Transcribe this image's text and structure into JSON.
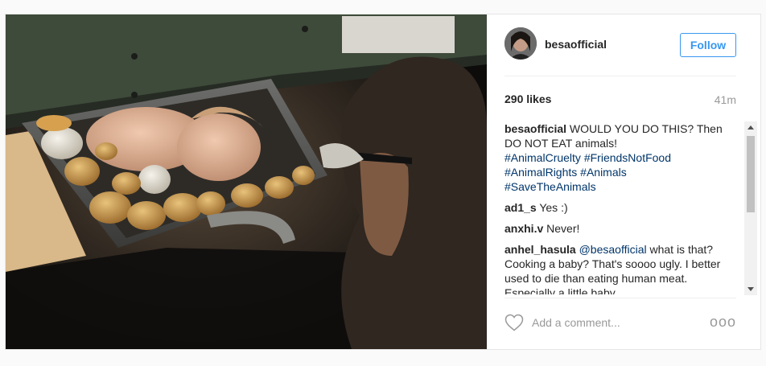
{
  "post": {
    "username": "besaofficial",
    "follow_label": "Follow",
    "likes": "290 likes",
    "time_ago": "41m",
    "caption": {
      "user": "besaofficial",
      "text": "WOULD YOU DO THIS? Then DO NOT EAT animals!",
      "hashtags": [
        "#AnimalCruelty",
        "#FriendsNotFood",
        "#AnimalRights",
        "#Animals",
        "#SaveTheAnimals"
      ]
    },
    "comments": [
      {
        "user": "ad1_s",
        "text": "Yes :)"
      },
      {
        "user": "anxhi.v",
        "text": "Never!"
      },
      {
        "user": "anhel_hasula",
        "mention": "@besaofficial",
        "text": "what is that? Cooking a baby? That's soooo ugly. I better used to die than eating human meat. Especially a little baby"
      }
    ],
    "comment_placeholder": "Add a comment...",
    "more_label": "ooo",
    "colors": {
      "accent": "#3897f0",
      "hashtag": "#003569",
      "muted": "#999999"
    },
    "icons": {
      "like": "heart-icon",
      "options": "more-options-icon"
    }
  }
}
